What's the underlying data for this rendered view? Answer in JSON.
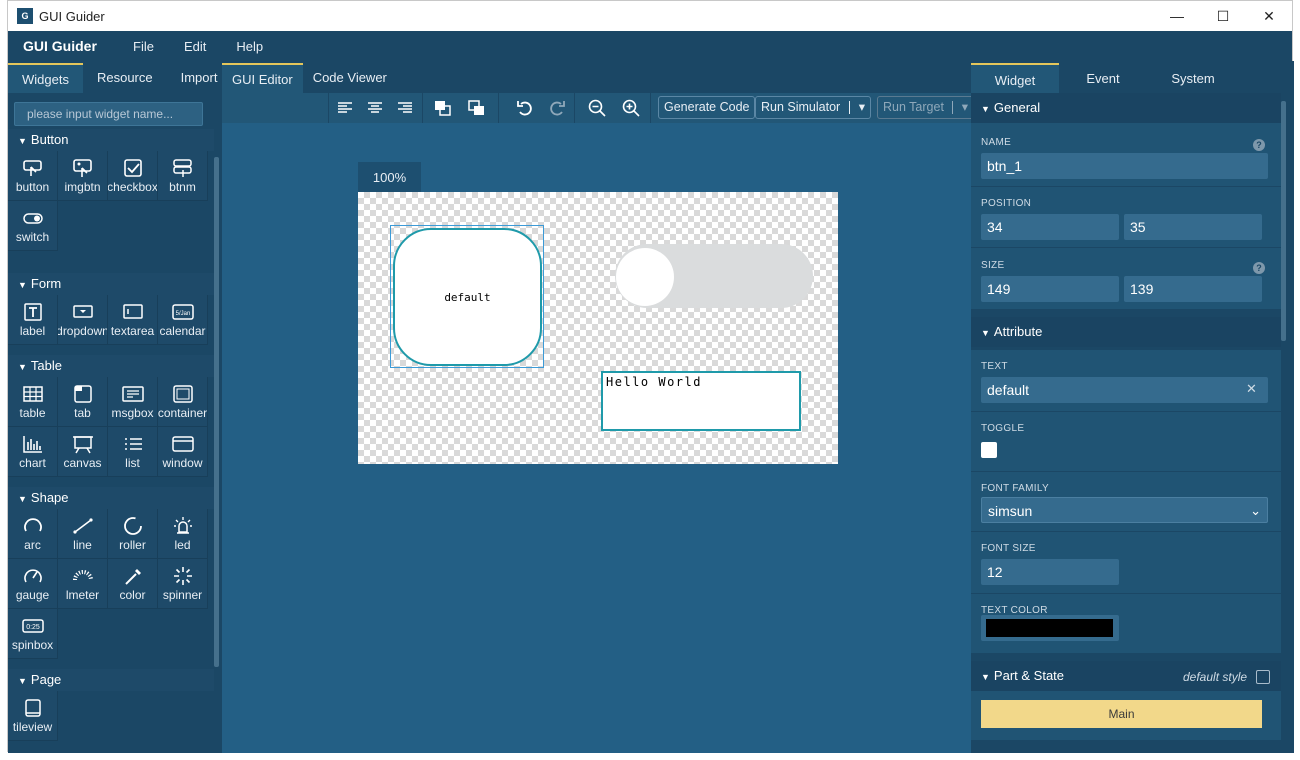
{
  "window": {
    "title": "GUI Guider",
    "minimize": "—",
    "maximize": "☐",
    "close": "✕"
  },
  "menubar": {
    "brand": "GUI Guider",
    "items": [
      "File",
      "Edit",
      "Help"
    ]
  },
  "left_panel": {
    "tabs": [
      "Widgets",
      "Resource",
      "Import"
    ],
    "active_tab": "Widgets",
    "search_placeholder": "please input widget name...",
    "sections": [
      {
        "title": "Button",
        "items": [
          "button",
          "imgbtn",
          "checkbox",
          "btnm",
          "switch"
        ]
      },
      {
        "title": "Form",
        "items": [
          "label",
          "dropdown",
          "textarea",
          "calendar"
        ]
      },
      {
        "title": "Table",
        "items": [
          "table",
          "tab",
          "msgbox",
          "container",
          "chart",
          "canvas",
          "list",
          "window"
        ]
      },
      {
        "title": "Shape",
        "items": [
          "arc",
          "line",
          "roller",
          "led",
          "gauge",
          "lmeter",
          "color",
          "spinner",
          "spinbox"
        ]
      },
      {
        "title": "Page",
        "items": [
          "tileview"
        ]
      }
    ]
  },
  "center": {
    "tabs": [
      "GUI Editor",
      "Code Viewer"
    ],
    "active_tab": "GUI Editor",
    "toolbar": {
      "generate_code": "Generate Code",
      "run_simulator": "Run Simulator",
      "run_target": "Run Target"
    },
    "zoom": "100%",
    "screen": {
      "button_text": "default",
      "label_text": "Hello World"
    }
  },
  "right_panel": {
    "tabs": [
      "Widget",
      "Event",
      "System"
    ],
    "active_tab": "Widget",
    "general": {
      "title": "General",
      "name_label": "NAME",
      "name_value": "btn_1",
      "position_label": "POSITION",
      "pos_x": "34",
      "pos_y": "35",
      "size_label": "SIZE",
      "width": "149",
      "height": "139"
    },
    "attribute": {
      "title": "Attribute",
      "text_label": "TEXT",
      "text_value": "default",
      "toggle_label": "TOGGLE",
      "font_family_label": "FONT FAMILY",
      "font_family_value": "simsun",
      "font_size_label": "FONT SIZE",
      "font_size_value": "12",
      "text_color_label": "TEXT COLOR",
      "text_color_value": "#000000"
    },
    "part_state": {
      "title": "Part & State",
      "default_style": "default style",
      "main": "Main"
    }
  },
  "colors": {
    "accent": "#e4c65b",
    "panel": "#1b4765",
    "canvas": "#235f85",
    "widget_border": "#1f9aaa",
    "main_bar": "#f2d88a"
  }
}
